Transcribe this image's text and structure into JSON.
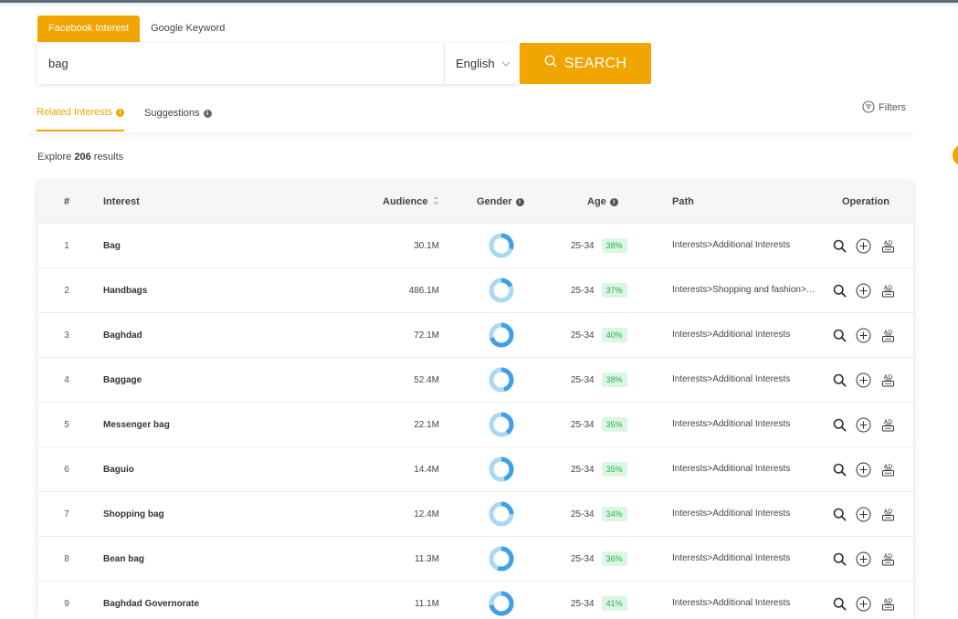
{
  "source_tabs": [
    {
      "label": "Facebook Interest",
      "active": true
    },
    {
      "label": "Google Keyword",
      "active": false
    }
  ],
  "search": {
    "value": "bag",
    "language": "English",
    "button_label": "SEARCH"
  },
  "result_tabs": [
    {
      "label": "Related Interests",
      "active": true
    },
    {
      "label": "Suggestions",
      "active": false
    }
  ],
  "filters_label": "Filters",
  "explore": {
    "prefix": "Explore",
    "count": "206",
    "suffix": "results"
  },
  "table": {
    "headers": {
      "num": "#",
      "interest": "Interest",
      "audience": "Audience",
      "gender": "Gender",
      "age": "Age",
      "path": "Path",
      "operation": "Operation"
    },
    "rows": [
      {
        "num": "1",
        "interest": "Bag",
        "audience": "30.1M",
        "male_share": 0.3,
        "age": "25-34",
        "age_pct": "38%",
        "path": "Interests>Additional Interests"
      },
      {
        "num": "2",
        "interest": "Handbags",
        "audience": "486.1M",
        "male_share": 0.18,
        "age": "25-34",
        "age_pct": "37%",
        "path": "Interests>Shopping and fashion>Clothing"
      },
      {
        "num": "3",
        "interest": "Baghdad",
        "audience": "72.1M",
        "male_share": 0.7,
        "age": "25-34",
        "age_pct": "40%",
        "path": "Interests>Additional Interests"
      },
      {
        "num": "4",
        "interest": "Baggage",
        "audience": "52.4M",
        "male_share": 0.45,
        "age": "25-34",
        "age_pct": "38%",
        "path": "Interests>Additional Interests"
      },
      {
        "num": "5",
        "interest": "Messenger bag",
        "audience": "22.1M",
        "male_share": 0.4,
        "age": "25-34",
        "age_pct": "35%",
        "path": "Interests>Additional Interests"
      },
      {
        "num": "6",
        "interest": "Baguio",
        "audience": "14.4M",
        "male_share": 0.45,
        "age": "25-34",
        "age_pct": "35%",
        "path": "Interests>Additional Interests"
      },
      {
        "num": "7",
        "interest": "Shopping bag",
        "audience": "12.4M",
        "male_share": 0.25,
        "age": "25-34",
        "age_pct": "34%",
        "path": "Interests>Additional Interests"
      },
      {
        "num": "8",
        "interest": "Bean bag",
        "audience": "11.3M",
        "male_share": 0.55,
        "age": "25-34",
        "age_pct": "36%",
        "path": "Interests>Additional Interests"
      },
      {
        "num": "9",
        "interest": "Baghdad Governorate",
        "audience": "11.1M",
        "male_share": 0.72,
        "age": "25-34",
        "age_pct": "41%",
        "path": "Interests>Additional Interests"
      }
    ]
  },
  "icons": {
    "search": "search-icon",
    "chevron": "chevron-down-icon",
    "filters": "filter-icon",
    "info": "info-icon",
    "sort": "sort-icon",
    "magnify": "magnify-icon",
    "add": "add-circle-icon",
    "ad": "ad-icon"
  },
  "colors": {
    "accent": "#f0a500",
    "donut_male": "#3fa0e8",
    "donut_female": "#a9d8f5",
    "pct_bg": "#ddf6e3",
    "pct_text": "#22b14c",
    "header_bg": "#f5f6f8"
  }
}
